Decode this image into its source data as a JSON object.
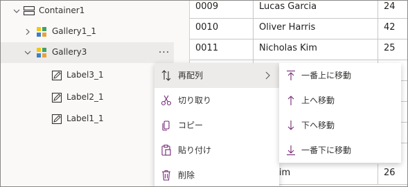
{
  "tree": {
    "items": [
      {
        "label": "Container1",
        "icon": "container-icon"
      },
      {
        "label": "Gallery1_1",
        "icon": "gallery-icon"
      },
      {
        "label": "Gallery3",
        "icon": "gallery-icon"
      },
      {
        "label": "Label3_1",
        "icon": "label-icon"
      },
      {
        "label": "Label2_1",
        "icon": "label-icon"
      },
      {
        "label": "Label1_1",
        "icon": "label-icon"
      }
    ],
    "more_label": "···"
  },
  "table": {
    "rows": [
      {
        "id": "0009",
        "name": "Lucas Garcia",
        "extra": "24"
      },
      {
        "id": "0010",
        "name": "Oliver Harris",
        "extra": "42"
      },
      {
        "id": "0011",
        "name": "Nicholas Kim",
        "extra": "25"
      },
      {
        "id": "",
        "name": "",
        "extra": ""
      },
      {
        "id": "",
        "name": "",
        "extra": ""
      },
      {
        "id": "",
        "name": "",
        "extra": ""
      },
      {
        "id": "",
        "name": "",
        "extra": ""
      },
      {
        "id": "",
        "name": "na Kim",
        "extra": "26"
      }
    ]
  },
  "context_menu": {
    "items": [
      {
        "label": "再配列",
        "icon": "reorder-icon",
        "has_submenu": true
      },
      {
        "label": "切り取り",
        "icon": "scissors-icon"
      },
      {
        "label": "コピー",
        "icon": "copy-icon"
      },
      {
        "label": "貼り付け",
        "icon": "paste-icon"
      },
      {
        "label": "削除",
        "icon": "trash-icon"
      }
    ]
  },
  "submenu": {
    "items": [
      {
        "label": "一番上に移動",
        "icon": "move-to-top-icon"
      },
      {
        "label": "上へ移動",
        "icon": "arrow-up-icon"
      },
      {
        "label": "下へ移動",
        "icon": "arrow-down-icon"
      },
      {
        "label": "一番下に移動",
        "icon": "move-to-bottom-icon"
      }
    ]
  },
  "colors": {
    "accent_purple": "#742774",
    "gallery_yellow": "#f2c811",
    "gallery_green": "#44a06a",
    "gallery_blue": "#3e7fc4",
    "selected_bg": "#edebe9"
  }
}
